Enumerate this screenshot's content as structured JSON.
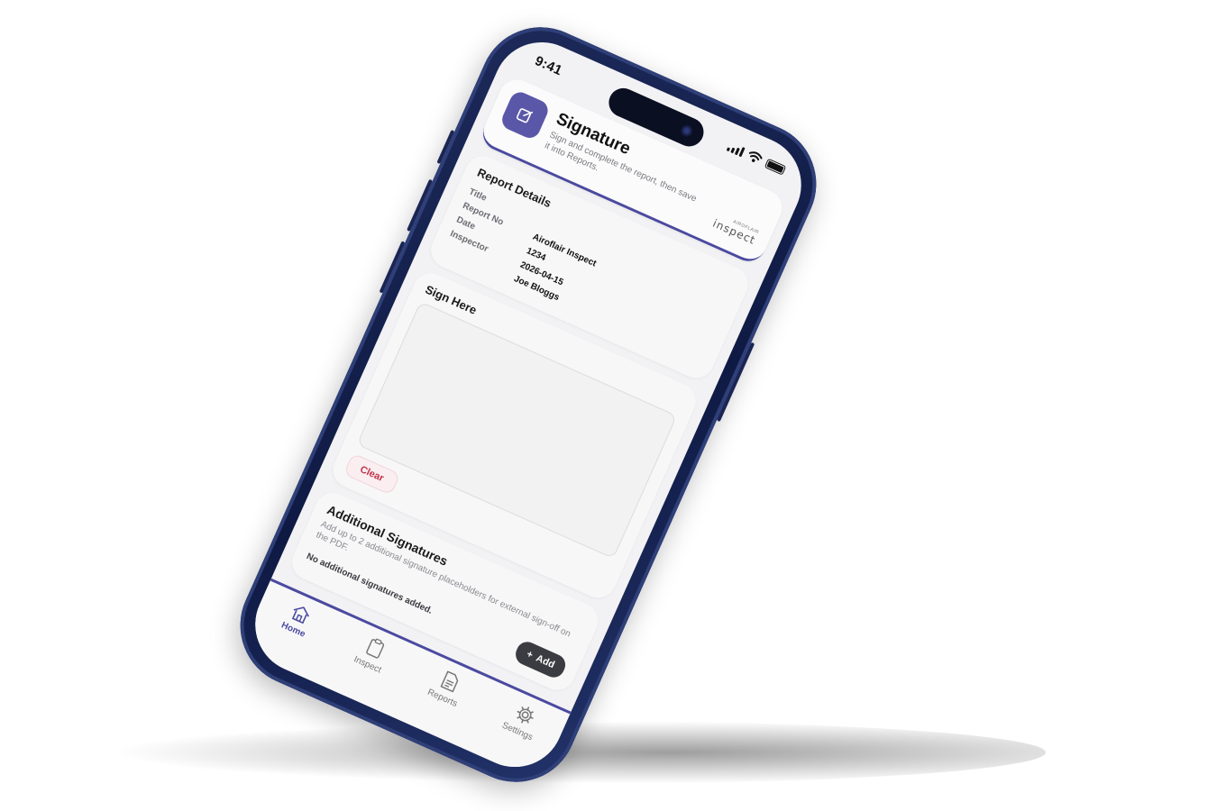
{
  "status": {
    "time": "9:41"
  },
  "header": {
    "title": "Signature",
    "subtitle": "Sign and complete the report, then save it into Reports.",
    "logo_small": "AIROFLAIR",
    "logo_main": "inspect"
  },
  "report_details": {
    "title": "Report Details",
    "rows": [
      {
        "label": "Title",
        "value": ""
      },
      {
        "label": "Report No",
        "value": "Airoflair Inspect"
      },
      {
        "label": "Date",
        "value": "1234"
      },
      {
        "label": "Inspector",
        "value": "2026-04-15"
      },
      {
        "label": "",
        "value": "Joe Bloggs"
      }
    ]
  },
  "sign": {
    "title": "Sign Here",
    "clear_label": "Clear"
  },
  "additional": {
    "title": "Additional Signatures",
    "description": "Add up to 2 additional signature placeholders for external sign-off on the PDF.",
    "empty_text": "No additional signatures added.",
    "add_label": "Add",
    "add_icon": "+"
  },
  "tabs": [
    {
      "label": "Home",
      "icon": "home-icon",
      "active": true
    },
    {
      "label": "Inspect",
      "icon": "clipboard-icon",
      "active": false
    },
    {
      "label": "Reports",
      "icon": "document-icon",
      "active": false
    },
    {
      "label": "Settings",
      "icon": "gear-icon",
      "active": false
    }
  ],
  "colors": {
    "accent": "#4b4aa0",
    "icon_bg": "#5b57a8",
    "clear_text": "#c0334d",
    "frame": "#1d2a5a"
  }
}
